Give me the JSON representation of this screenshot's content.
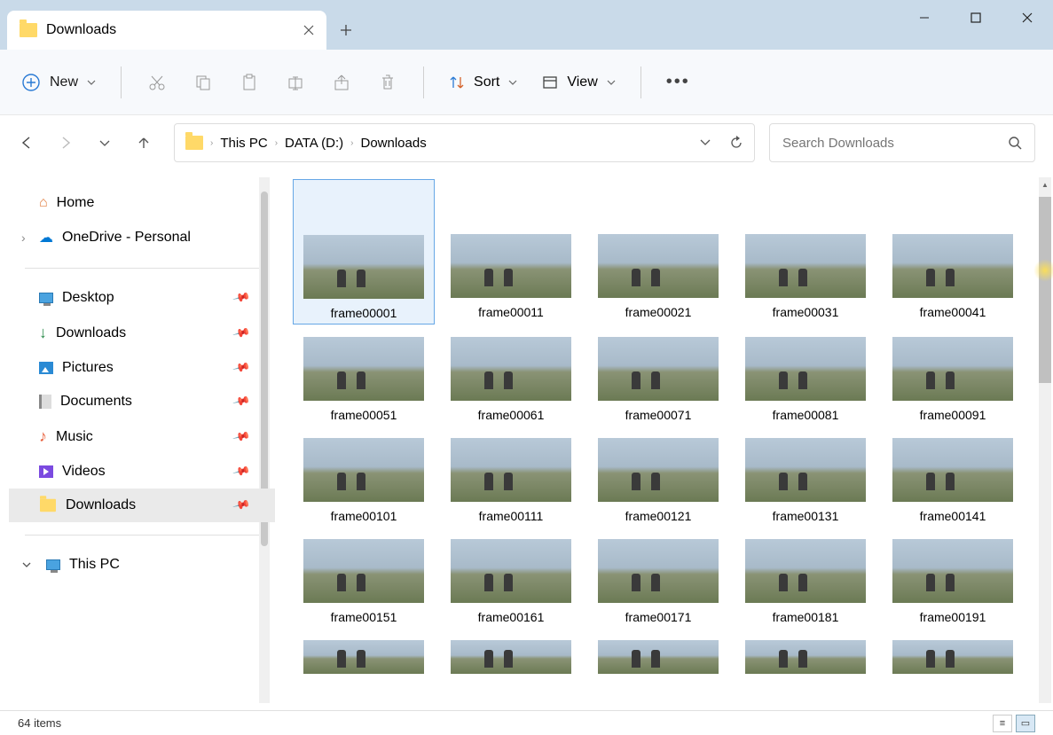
{
  "tab": {
    "title": "Downloads"
  },
  "toolbar": {
    "new_label": "New",
    "sort_label": "Sort",
    "view_label": "View"
  },
  "breadcrumbs": {
    "c0": "This PC",
    "c1": "DATA (D:)",
    "c2": "Downloads"
  },
  "search": {
    "placeholder": "Search Downloads"
  },
  "sidebar": {
    "home": "Home",
    "onedrive": "OneDrive - Personal",
    "desktop": "Desktop",
    "downloads_q": "Downloads",
    "pictures": "Pictures",
    "documents": "Documents",
    "music": "Music",
    "videos": "Videos",
    "downloads": "Downloads",
    "this_pc": "This PC"
  },
  "files": {
    "f0": "frame00001",
    "f1": "frame00011",
    "f2": "frame00021",
    "f3": "frame00031",
    "f4": "frame00041",
    "f5": "frame00051",
    "f6": "frame00061",
    "f7": "frame00071",
    "f8": "frame00081",
    "f9": "frame00091",
    "f10": "frame00101",
    "f11": "frame00111",
    "f12": "frame00121",
    "f13": "frame00131",
    "f14": "frame00141",
    "f15": "frame00151",
    "f16": "frame00161",
    "f17": "frame00171",
    "f18": "frame00181",
    "f19": "frame00191"
  },
  "status": {
    "items": "64 items"
  }
}
